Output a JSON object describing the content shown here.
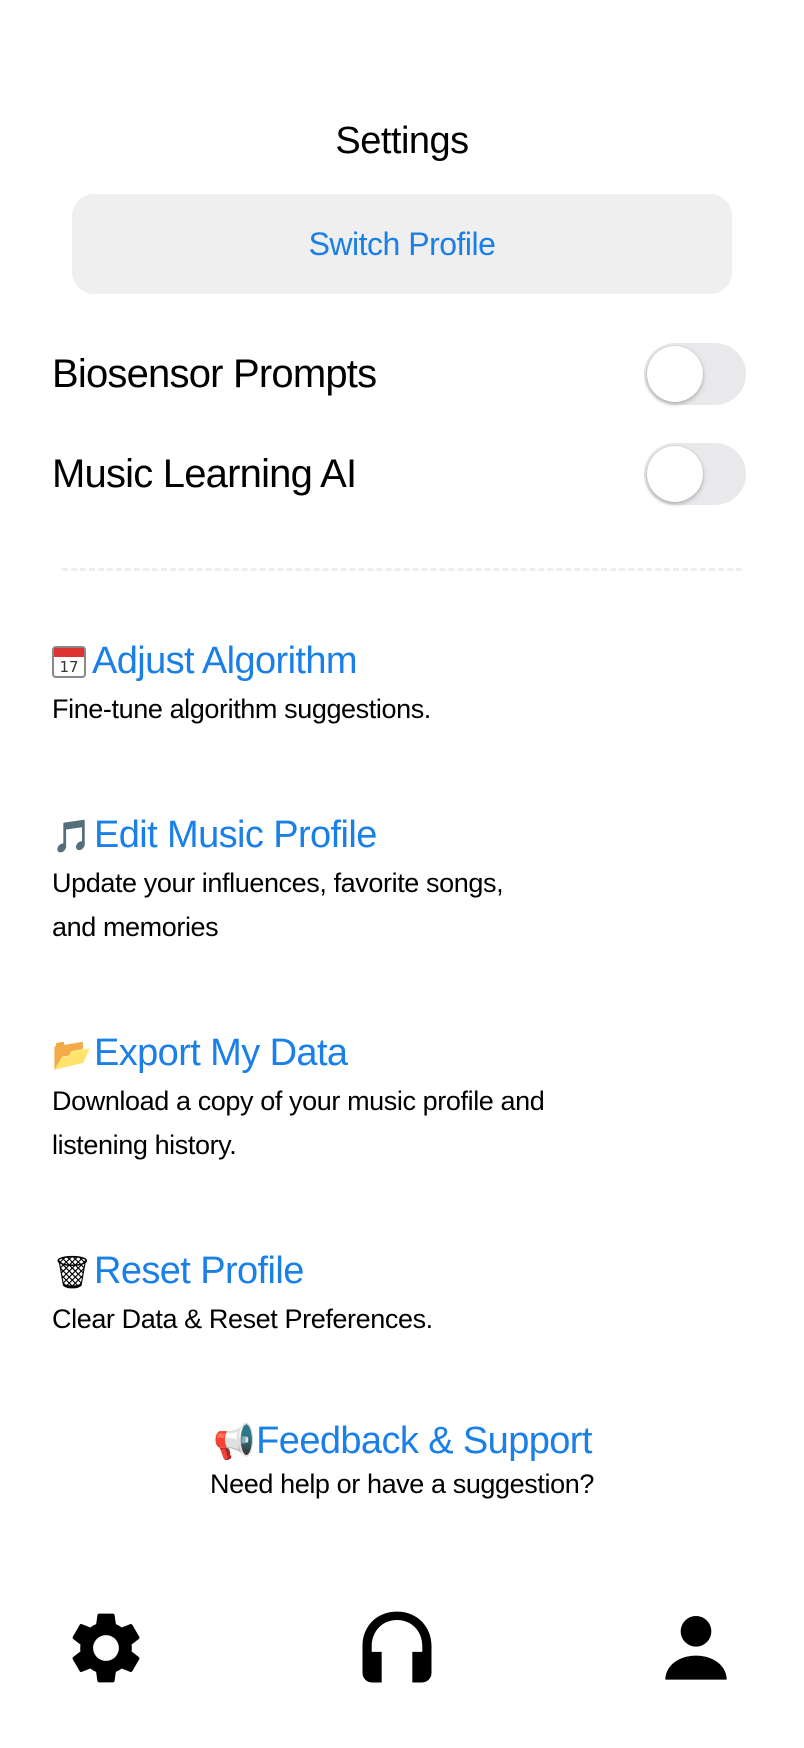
{
  "header": {
    "title": "Settings"
  },
  "switch_profile": {
    "label": "Switch Profile"
  },
  "toggles": [
    {
      "label": "Biosensor Prompts",
      "on": false
    },
    {
      "label": "Music Learning AI",
      "on": false
    }
  ],
  "items": [
    {
      "icon": "calendar-icon",
      "calendar_text": "17",
      "label": "Adjust Algorithm",
      "desc": "Fine-tune algorithm suggestions."
    },
    {
      "icon": "music-note-icon",
      "emoji": "🎵",
      "label": "Edit Music Profile",
      "desc": "Update your influences, favorite songs, and memories"
    },
    {
      "icon": "folder-icon",
      "emoji": "📂",
      "label": "Export My Data",
      "desc": "Download a copy of your music profile and listening history."
    },
    {
      "icon": "wastebasket-icon",
      "emoji": "🗑",
      "label": "Reset Profile",
      "desc": "Clear Data & Reset Preferences."
    }
  ],
  "feedback": {
    "icon": "megaphone-icon",
    "emoji": "📢",
    "label": "Feedback & Support",
    "desc": "Need help or have a suggestion?"
  },
  "tabbar": {
    "tabs": [
      "settings",
      "listen",
      "profile"
    ]
  },
  "colors": {
    "accent": "#1a7fe6",
    "button_bg": "#efefef",
    "toggle_off": "#e9e9eb"
  }
}
